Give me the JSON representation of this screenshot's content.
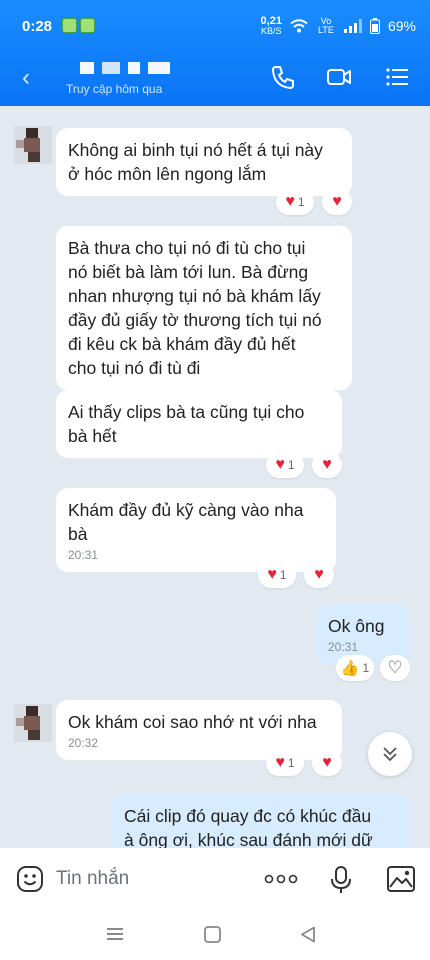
{
  "status_bar": {
    "time": "0:28",
    "speed_value": "0,21",
    "speed_unit": "KB/S",
    "volte": "Vo LTE",
    "battery": "69%"
  },
  "header": {
    "subtitle": "Truy cập hôm qua",
    "back_icon": "back-arrow-icon",
    "call_icon": "phone-icon",
    "video_icon": "video-icon",
    "menu_icon": "menu-icon"
  },
  "messages": [
    {
      "side": "left",
      "text": "Không ai binh tụi nó hết á tụi này\nở hóc môn lên ngong lắm",
      "time": "",
      "reaction_count": "1"
    },
    {
      "side": "left",
      "text": "Bà thưa cho tụi nó đi tù cho tụi\nnó biết bà làm tới lun. Bà đừng\nnhan nhượng tụi nó bà khám lấy\nđầy đủ giấy tờ thương tích tụi nó\nđi kêu ck bà khám đầy đủ hết\ncho tụi nó đi tù đi",
      "time": "",
      "reaction_count": ""
    },
    {
      "side": "left",
      "text": "Ai thấy clips bà ta cũng tụi cho\nbà hết",
      "time": "",
      "reaction_count": "1"
    },
    {
      "side": "left",
      "text": "Khám đầy đủ kỹ càng vào nha\nbà",
      "time": "20:31",
      "reaction_count": "1"
    },
    {
      "side": "right",
      "text": "Ok ông",
      "time": "20:31",
      "reaction_count": "1"
    },
    {
      "side": "left",
      "text": "Ok khám coi sao nhớ nt với nha",
      "time": "20:32",
      "reaction_count": "1"
    },
    {
      "side": "right",
      "text": "Cái clip đó quay đc có khúc đầu\nà ông ơi, khúc sau đánh mới dữ",
      "time": "",
      "reaction_count": ""
    }
  ],
  "composer": {
    "placeholder": "Tin nhắn"
  },
  "colors": {
    "header_blue": "#0a74f5",
    "chat_bg": "#e2e9f1",
    "own_bubble": "#d7ecff",
    "heart_red": "#e3243b"
  }
}
